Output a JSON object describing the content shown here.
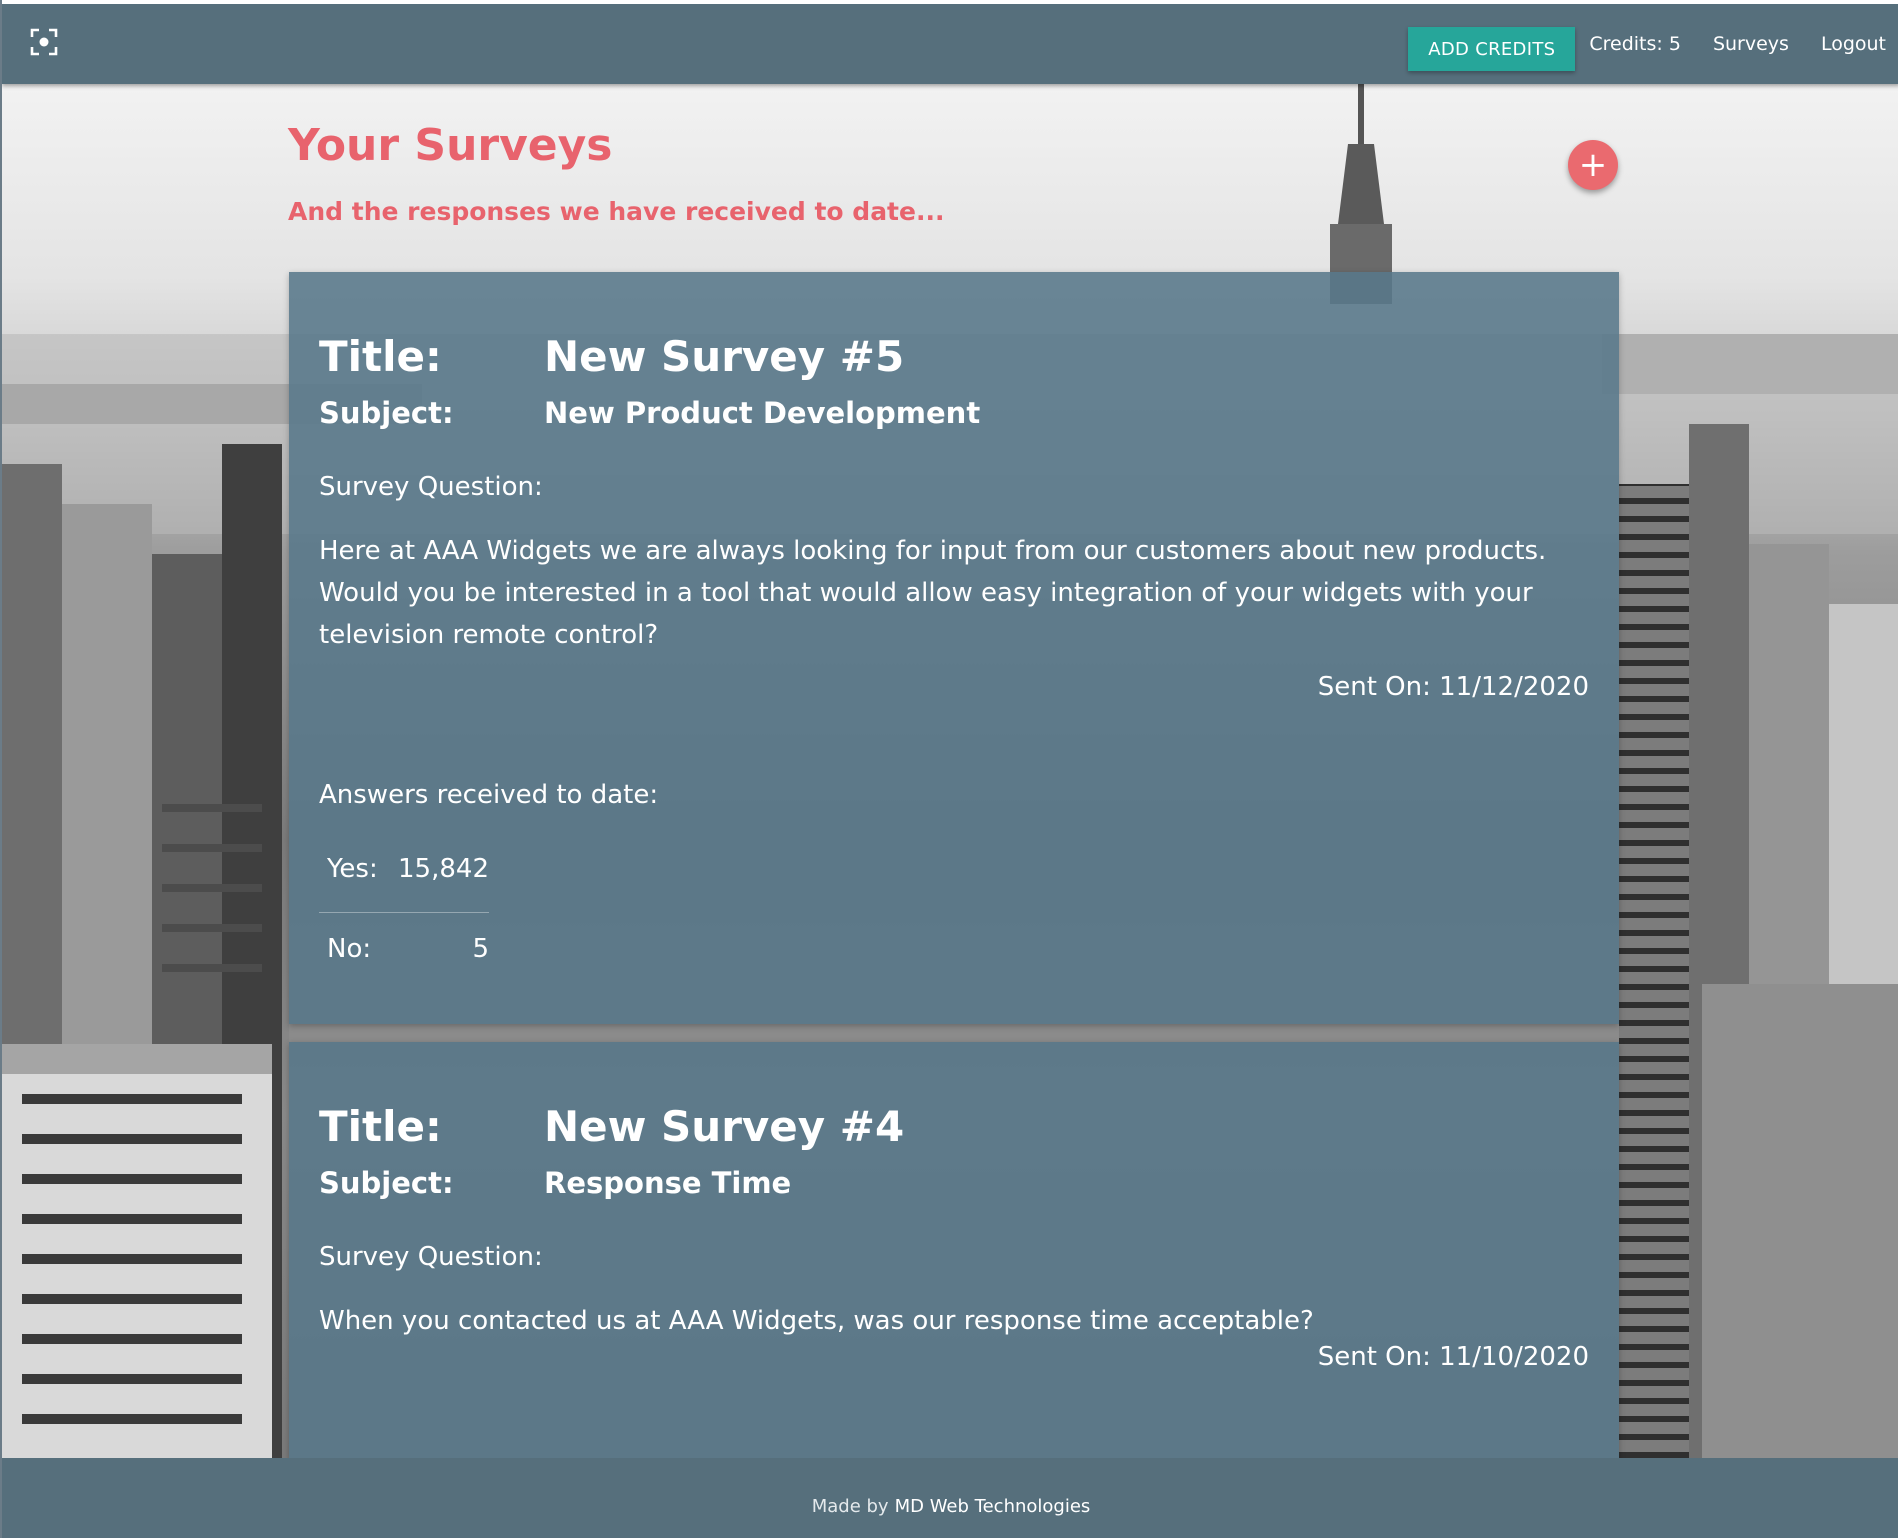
{
  "navbar": {
    "logo_icon": "focus-frame-icon",
    "add_credits_label": "ADD CREDITS",
    "credits_text": "Credits: 5",
    "surveys_link": "Surveys",
    "logout_link": "Logout",
    "add_credits_color": "#26a69a",
    "bar_color": "#566f7c"
  },
  "header": {
    "title": "Your Surveys",
    "subtitle": "And the responses we have received to date...",
    "add_survey_button_label": "+",
    "accent_color": "#e8636d"
  },
  "surveys": [
    {
      "title_label": "Title:",
      "title": "New Survey #5",
      "subject_label": "Subject:",
      "subject": "New Product Development",
      "question_label": "Survey Question:",
      "question": "Here at AAA Widgets we are always looking for input from our customers about new products. Would you be interested in a tool that would allow easy integration of your widgets with your television remote control?",
      "sent_on": "Sent On: 11/12/2020",
      "answers_label": "Answers received to date:",
      "answers": [
        {
          "label": "Yes:",
          "value": "15,842"
        },
        {
          "label": "No:",
          "value": "5"
        }
      ]
    },
    {
      "title_label": "Title:",
      "title": "New Survey #4",
      "subject_label": "Subject:",
      "subject": "Response Time",
      "question_label": "Survey Question:",
      "question": "When you contacted us at AAA Widgets, was our response time acceptable?",
      "sent_on": "Sent On: 11/10/2020"
    }
  ],
  "footer": {
    "made_by": "Made by",
    "company": "MD Web Technologies"
  }
}
